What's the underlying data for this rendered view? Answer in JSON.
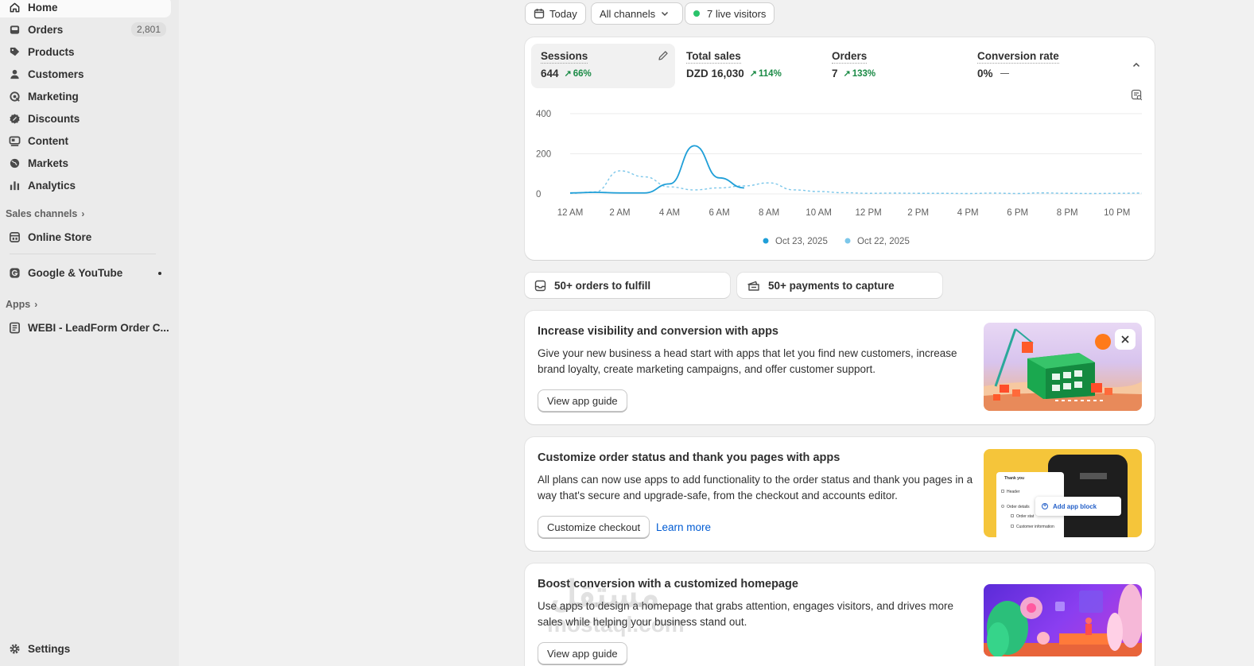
{
  "sidebar": {
    "items": [
      {
        "label": "Home",
        "icon": "home-icon",
        "active": true
      },
      {
        "label": "Orders",
        "icon": "inbox-icon",
        "badge": "2,801"
      },
      {
        "label": "Products",
        "icon": "tag-icon"
      },
      {
        "label": "Customers",
        "icon": "person-icon"
      },
      {
        "label": "Marketing",
        "icon": "target-icon"
      },
      {
        "label": "Discounts",
        "icon": "discount-icon"
      },
      {
        "label": "Content",
        "icon": "content-icon"
      },
      {
        "label": "Markets",
        "icon": "globe-icon"
      },
      {
        "label": "Analytics",
        "icon": "bar-chart-icon"
      }
    ],
    "sales_channels_label": "Sales channels",
    "online_store_label": "Online Store",
    "google_label": "Google & YouTube",
    "apps_label": "Apps",
    "app_item_label": "WEBI - LeadForm Order C...",
    "settings_label": "Settings"
  },
  "filters": {
    "date_label": "Today",
    "channels_label": "All channels",
    "live_visitors_label": "7 live visitors"
  },
  "metrics": [
    {
      "label": "Sessions",
      "value": "644",
      "change": "66%"
    },
    {
      "label": "Total sales",
      "value": "DZD 16,030",
      "change": "114%"
    },
    {
      "label": "Orders",
      "value": "7",
      "change": "133%"
    },
    {
      "label": "Conversion rate",
      "value": "0%",
      "change": ""
    }
  ],
  "chart_data": {
    "type": "line",
    "x": [
      "12 AM",
      "1 AM",
      "2 AM",
      "3 AM",
      "4 AM",
      "5 AM",
      "6 AM",
      "7 AM",
      "8 AM",
      "9 AM",
      "10 AM",
      "11 AM",
      "12 PM",
      "1 PM",
      "2 PM",
      "3 PM",
      "4 PM",
      "5 PM",
      "6 PM",
      "7 PM",
      "8 PM",
      "9 PM",
      "10 PM",
      "11 PM"
    ],
    "x_tick_labels": [
      "12 AM",
      "2 AM",
      "4 AM",
      "6 AM",
      "8 AM",
      "10 AM",
      "12 PM",
      "2 PM",
      "4 PM",
      "6 PM",
      "8 PM",
      "10 PM"
    ],
    "y_ticks": [
      "400",
      "200",
      "0"
    ],
    "ylim": [
      0,
      400
    ],
    "grid": true,
    "legend_position": "bottom",
    "series": [
      {
        "name": "Oct 23, 2025",
        "color": "#1f9fd8",
        "style": "solid",
        "values": [
          5,
          8,
          5,
          5,
          50,
          240,
          80,
          30,
          null,
          null,
          null,
          null,
          null,
          null,
          null,
          null,
          null,
          null,
          null,
          null,
          null,
          null,
          null,
          null
        ]
      },
      {
        "name": "Oct 22, 2025",
        "color": "#7cc7ea",
        "style": "dashed",
        "values": [
          3,
          10,
          115,
          85,
          35,
          20,
          30,
          40,
          55,
          20,
          12,
          6,
          3,
          4,
          3,
          3,
          2,
          4,
          2,
          5,
          3,
          2,
          3,
          4
        ]
      }
    ]
  },
  "tasks": {
    "fulfill_label": "50+ orders to fulfill",
    "capture_label": "50+ payments to capture"
  },
  "promos": [
    {
      "title": "Increase visibility and conversion with apps",
      "body": "Give your new business a head start with apps that let you find new customers, increase brand loyalty, create marketing campaigns, and offer customer support.",
      "button": "View app guide"
    },
    {
      "title": "Customize order status and thank you pages with apps",
      "body": "All plans can now use apps to add functionality to the order status and thank you pages in a way that's secure and upgrade-safe, from the checkout and accounts editor.",
      "button": "Customize checkout",
      "link": "Learn more",
      "mock": {
        "thank_you": "Thank you",
        "header": "Header",
        "order_details": "Order details",
        "order_status": "Order stat",
        "customer_info": "Customer information",
        "add_block": "Add app block"
      }
    },
    {
      "title": "Boost conversion with a customized homepage",
      "body": "Use apps to design a homepage that grabs attention, engages visitors, and drives more sales while helping your business stand out.",
      "button": "View app guide"
    }
  ],
  "watermark": {
    "arabic": "مستقل",
    "latin": "mostaql.com"
  },
  "colors": {
    "accent": "#005bd3",
    "positive": "#1a8a45",
    "live": "#29c36a",
    "sidebar_bg": "#ebebeb",
    "page_bg": "#f1f1f1"
  }
}
